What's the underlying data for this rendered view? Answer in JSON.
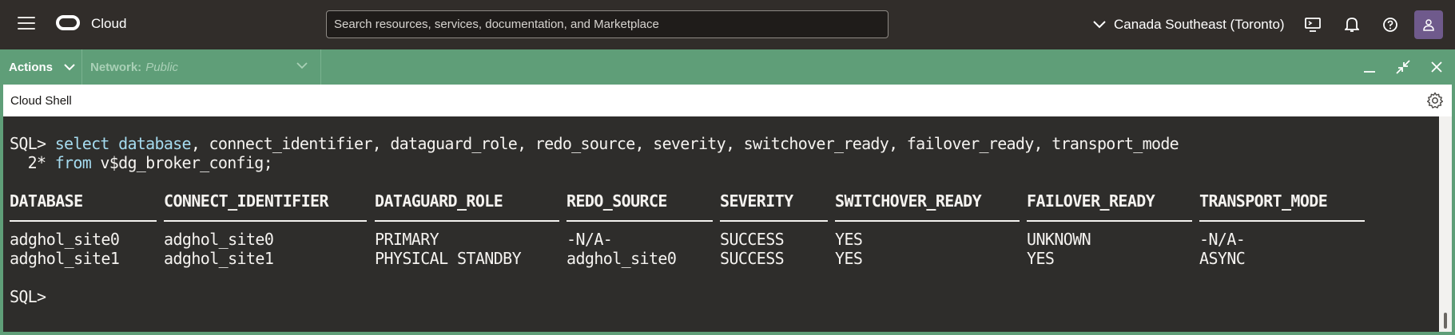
{
  "header": {
    "brand": "Cloud",
    "search_placeholder": "Search resources, services, documentation, and Marketplace",
    "region": "Canada Southeast (Toronto)"
  },
  "actionbar": {
    "actions_label": "Actions",
    "network_label": "Network:",
    "network_value": "Public"
  },
  "shell": {
    "title": "Cloud Shell"
  },
  "terminal": {
    "prompt": "SQL>",
    "query_line1_kw1": "select",
    "query_line1_kw2": "database",
    "query_line1_rest": ", connect_identifier, dataguard_role, redo_source, severity, switchover_ready, failover_ready, transport_mode",
    "query_line2_num": "  2*",
    "query_line2_kw": "from",
    "query_line2_rest": " v$dg_broker_config;",
    "columns": [
      "DATABASE",
      "CONNECT_IDENTIFIER",
      "DATAGUARD_ROLE",
      "REDO_SOURCE",
      "SEVERITY",
      "SWITCHOVER_READY",
      "FAILOVER_READY",
      "TRANSPORT_MODE"
    ],
    "rows": [
      [
        "adghol_site0",
        "adghol_site0",
        "PRIMARY",
        "-N/A-",
        "SUCCESS",
        "YES",
        "UNKNOWN",
        "-N/A-"
      ],
      [
        "adghol_site1",
        "adghol_site1",
        "PHYSICAL STANDBY",
        "adghol_site0",
        "SUCCESS",
        "YES",
        "YES",
        "ASYNC"
      ]
    ],
    "final_prompt": "SQL>"
  },
  "colors": {
    "topbar": "#312d2a",
    "actionbar": "#5f9e78",
    "terminal_bg": "#2e2d2b",
    "keyword": "#a5dbef"
  },
  "icons": [
    "hamburger-icon",
    "cloud-logo-icon",
    "chevron-down-icon",
    "cloud-shell-icon",
    "bell-icon",
    "help-icon",
    "user-icon",
    "minimize-icon",
    "restore-icon",
    "close-icon",
    "gear-icon"
  ]
}
